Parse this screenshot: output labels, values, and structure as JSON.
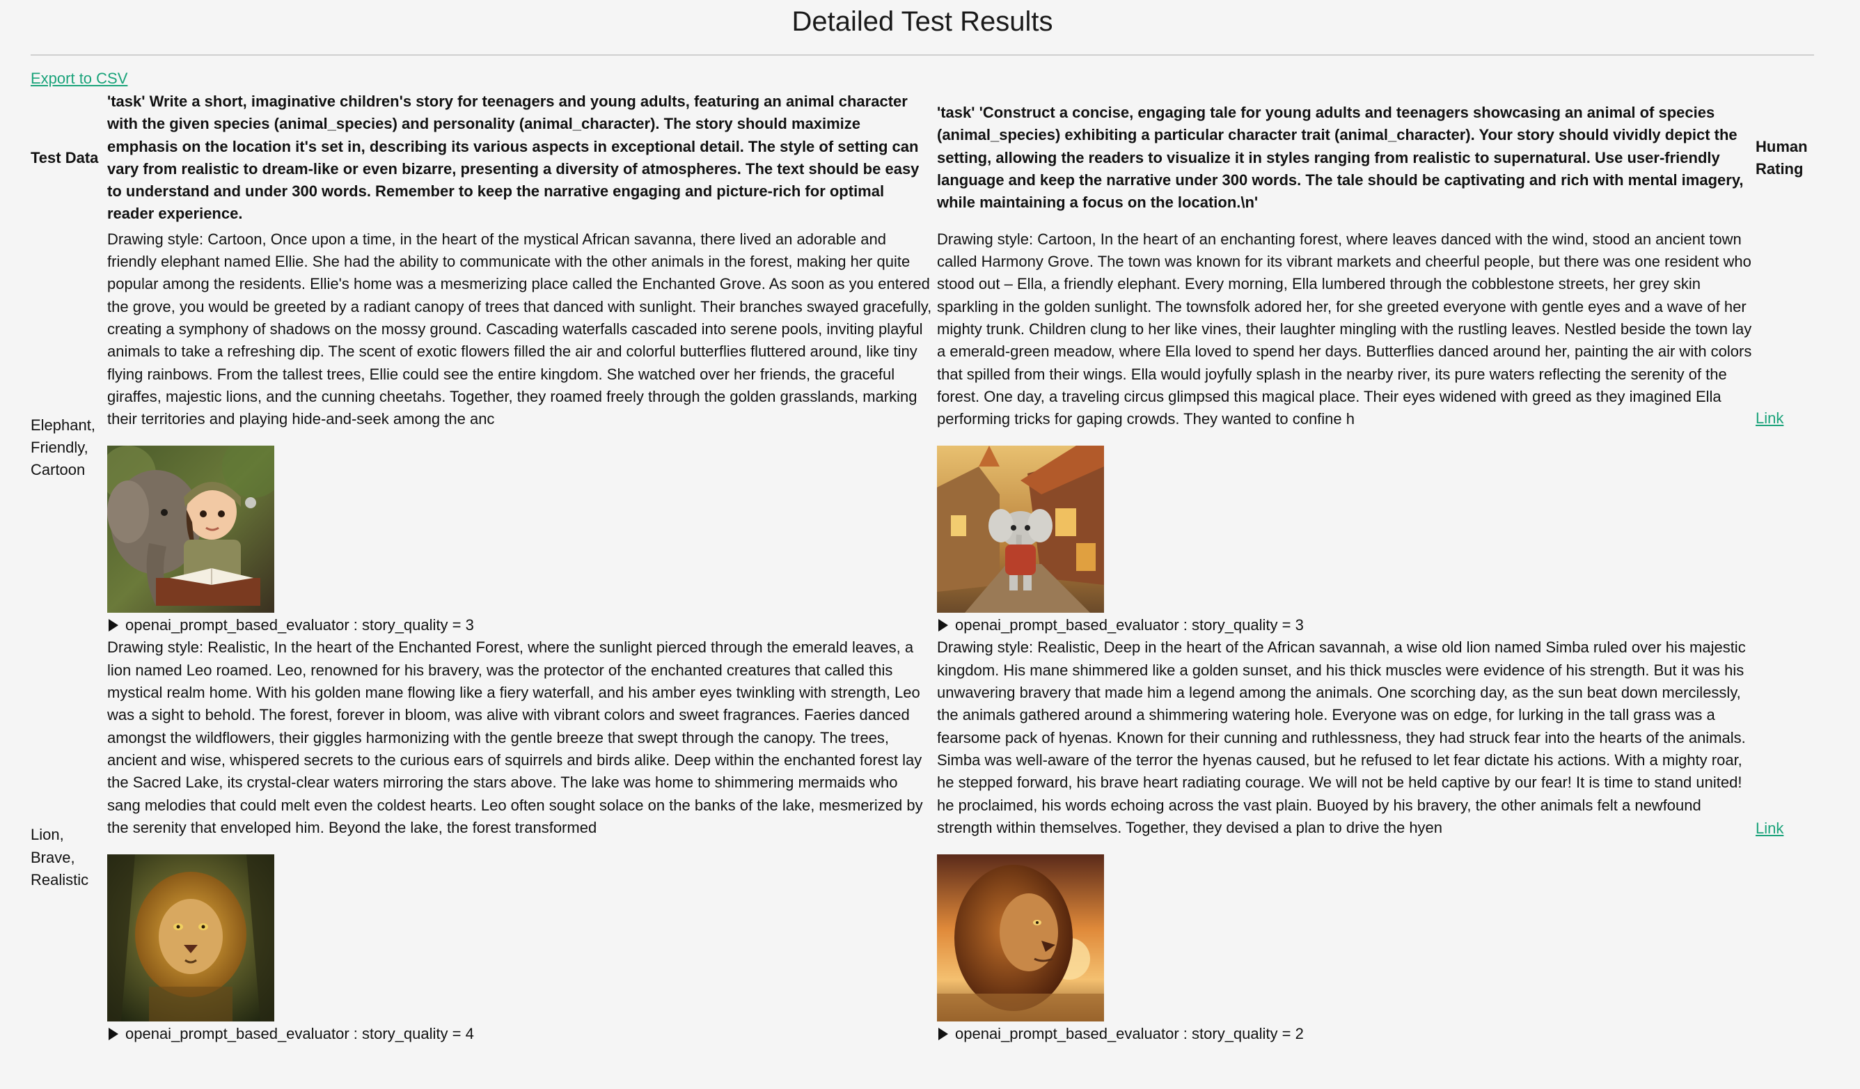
{
  "page": {
    "title": "Detailed Test Results",
    "export_label": "Export to CSV"
  },
  "table": {
    "headers": {
      "test_data": "Test Data",
      "human_rating": "Human Rating",
      "prompt_1": "'task' Write a short, imaginative children's story for teenagers and young adults, featuring an animal character with the given species (animal_species) and personality (animal_character). The story should maximize emphasis on the location it's set in, describing its various aspects in exceptional detail. The style of setting can vary from realistic to dream-like or even bizarre, presenting a diversity of atmospheres. The text should be easy to understand and under 300 words. Remember to keep the narrative engaging and picture-rich for optimal reader experience.",
      "prompt_2": "'task' 'Construct a concise, engaging tale for young adults and teenagers showcasing an animal of species (animal_species) exhibiting a particular character trait (animal_character). Your story should vividly depict the setting, allowing the readers to visualize it in styles ranging from realistic to supernatural. Use user-friendly language and keep the narrative under 300 words. The tale should be captivating and rich with mental imagery, while maintaining a focus on the location.\\n'"
    },
    "rows": [
      {
        "test_data": "Elephant, Friendly, Cartoon",
        "rating_link": "Link",
        "outputs": [
          {
            "story": "Drawing style: Cartoon, Once upon a time, in the heart of the mystical African savanna, there lived an adorable and friendly elephant named Ellie. She had the ability to communicate with the other animals in the forest, making her quite popular among the residents. Ellie's home was a mesmerizing place called the Enchanted Grove. As soon as you entered the grove, you would be greeted by a radiant canopy of trees that danced with sunlight. Their branches swayed gracefully, creating a symphony of shadows on the mossy ground. Cascading waterfalls cascaded into serene pools, inviting playful animals to take a refreshing dip. The scent of exotic flowers filled the air and colorful butterflies fluttered around, like tiny flying rainbows. From the tallest trees, Ellie could see the entire kingdom. She watched over her friends, the graceful giraffes, majestic lions, and the cunning cheetahs. Together, they roamed freely through the golden grasslands, marking their territories and playing hide-and-seek among the anc",
            "evaluation": "openai_prompt_based_evaluator : story_quality = 3",
            "image": "elephant-girl-drawing"
          },
          {
            "story": "Drawing style: Cartoon, In the heart of an enchanting forest, where leaves danced with the wind, stood an ancient town called Harmony Grove. The town was known for its vibrant markets and cheerful people, but there was one resident who stood out – Ella, a friendly elephant. Every morning, Ella lumbered through the cobblestone streets, her grey skin sparkling in the golden sunlight. The townsfolk adored her, for she greeted everyone with gentle eyes and a wave of her mighty trunk. Children clung to her like vines, their laughter mingling with the rustling leaves. Nestled beside the town lay a emerald-green meadow, where Ella loved to spend her days. Butterflies danced around her, painting the air with colors that spilled from their wings. Ella would joyfully splash in the nearby river, its pure waters reflecting the serenity of the forest. One day, a traveling circus glimpsed this magical place. Their eyes widened with greed as they imagined Ella performing tricks for gaping crowds. They wanted to confine h",
            "evaluation": "openai_prompt_based_evaluator : story_quality = 3",
            "image": "elephant-village-street"
          }
        ]
      },
      {
        "test_data": "Lion, Brave, Realistic",
        "rating_link": "Link",
        "outputs": [
          {
            "story": "Drawing style: Realistic, In the heart of the Enchanted Forest, where the sunlight pierced through the emerald leaves, a lion named Leo roamed. Leo, renowned for his bravery, was the protector of the enchanted creatures that called this mystical realm home. With his golden mane flowing like a fiery waterfall, and his amber eyes twinkling with strength, Leo was a sight to behold. The forest, forever in bloom, was alive with vibrant colors and sweet fragrances. Faeries danced amongst the wildflowers, their giggles harmonizing with the gentle breeze that swept through the canopy. The trees, ancient and wise, whispered secrets to the curious ears of squirrels and birds alike. Deep within the enchanted forest lay the Sacred Lake, its crystal-clear waters mirroring the stars above. The lake was home to shimmering mermaids who sang melodies that could melt even the coldest hearts. Leo often sought solace on the banks of the lake, mesmerized by the serenity that enveloped him. Beyond the lake, the forest transformed",
            "evaluation": "openai_prompt_based_evaluator : story_quality = 4",
            "image": "lion-forest"
          },
          {
            "story": "Drawing style: Realistic, Deep in the heart of the African savannah, a wise old lion named Simba ruled over his majestic kingdom. His mane shimmered like a golden sunset, and his thick muscles were evidence of his strength. But it was his unwavering bravery that made him a legend among the animals. One scorching day, as the sun beat down mercilessly, the animals gathered around a shimmering watering hole. Everyone was on edge, for lurking in the tall grass was a fearsome pack of hyenas. Known for their cunning and ruthlessness, they had struck fear into the hearts of the animals. Simba was well-aware of the terror the hyenas caused, but he refused to let fear dictate his actions. With a mighty roar, he stepped forward, his brave heart radiating courage. We will not be held captive by our fear! It is time to stand united! he proclaimed, his words echoing across the vast plain. Buoyed by his bravery, the other animals felt a newfound strength within themselves. Together, they devised a plan to drive the hyen",
            "evaluation": "openai_prompt_based_evaluator : story_quality = 2",
            "image": "lion-sunset"
          }
        ]
      }
    ]
  }
}
